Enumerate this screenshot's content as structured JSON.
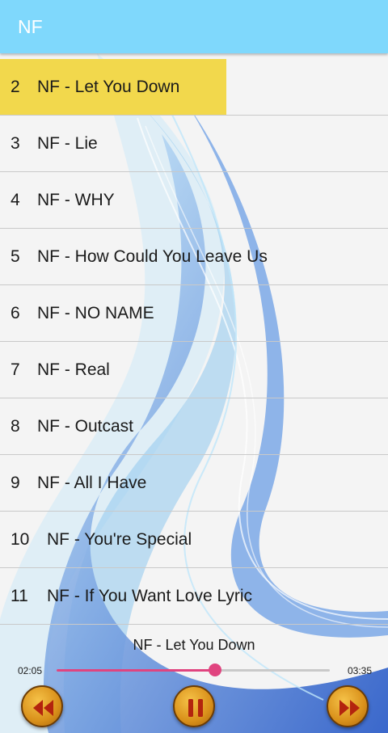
{
  "app": {
    "title": "NF"
  },
  "playlist": {
    "items": [
      {
        "num": "2",
        "title": "NF - Let You Down",
        "active": true
      },
      {
        "num": "3",
        "title": "NF - Lie"
      },
      {
        "num": "4",
        "title": "NF - WHY"
      },
      {
        "num": "5",
        "title": "NF - How Could You Leave Us"
      },
      {
        "num": "6",
        "title": "NF - NO NAME"
      },
      {
        "num": "7",
        "title": "NF - Real"
      },
      {
        "num": "8",
        "title": "NF - Outcast"
      },
      {
        "num": "9",
        "title": "NF - All I Have"
      },
      {
        "num": "10",
        "title": "NF - You're Special"
      },
      {
        "num": "11",
        "title": "NF - If You Want Love Lyric"
      }
    ]
  },
  "player": {
    "now_playing": "NF - Let You Down",
    "current_time": "02:05",
    "duration": "03:35",
    "progress": 0.58,
    "prev_icon": "rewind-icon",
    "pause_icon": "pause-icon",
    "next_icon": "fast-forward-icon"
  },
  "colors": {
    "appbar": "#7fd8fc",
    "active_row": "#f2d84c",
    "seek": "#e0447f",
    "control_gold": "#d9901a"
  }
}
